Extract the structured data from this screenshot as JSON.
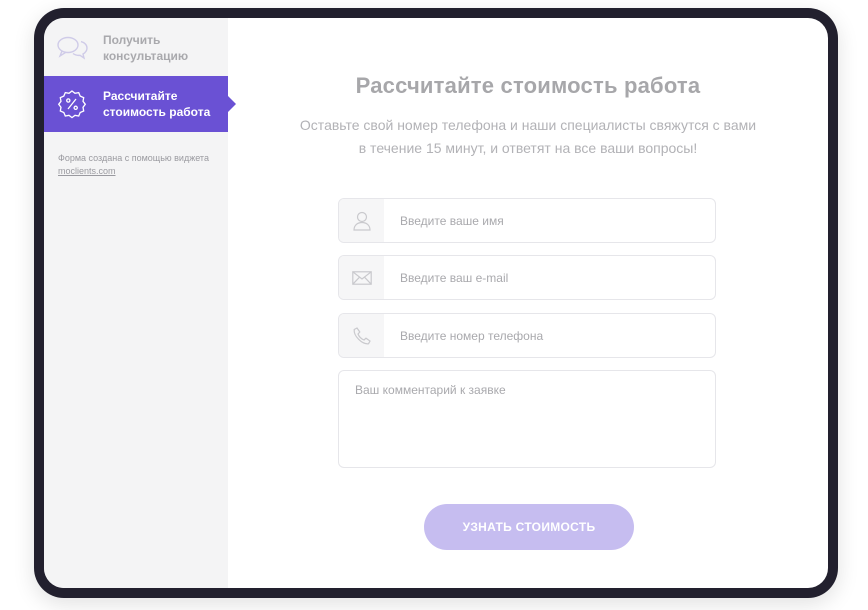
{
  "colors": {
    "accent": "#6a51d4",
    "button_bg": "#c6bdf0",
    "frame": "#22202e",
    "sidebar_bg": "#f4f4f5"
  },
  "sidebar": {
    "items": [
      {
        "label": "Получить консультацию",
        "icon": "chat-bubbles-icon",
        "active": false
      },
      {
        "label": "Рассчитайте стоимость работа",
        "icon": "percent-badge-icon",
        "active": true
      }
    ],
    "credits": {
      "text": "Форма создана с помощью виджета",
      "link": "moclients.com"
    }
  },
  "form": {
    "title": "Рассчитайте стоимость работа",
    "subtitle_line1": "Оставьте свой номер телефона и наши специалисты свяжутся с вами",
    "subtitle_line2": "в течение 15 минут, и ответят на все ваши вопросы!",
    "name_placeholder": "Введите ваше имя",
    "name_icon": "user-icon",
    "email_placeholder": "Введите ваш e-mail",
    "email_icon": "envelope-icon",
    "phone_placeholder": "Введите номер телефона",
    "phone_icon": "phone-icon",
    "comment_placeholder": "Ваш комментарий к заявке",
    "submit_label": "УЗНАТЬ СТОИМОСТЬ"
  }
}
